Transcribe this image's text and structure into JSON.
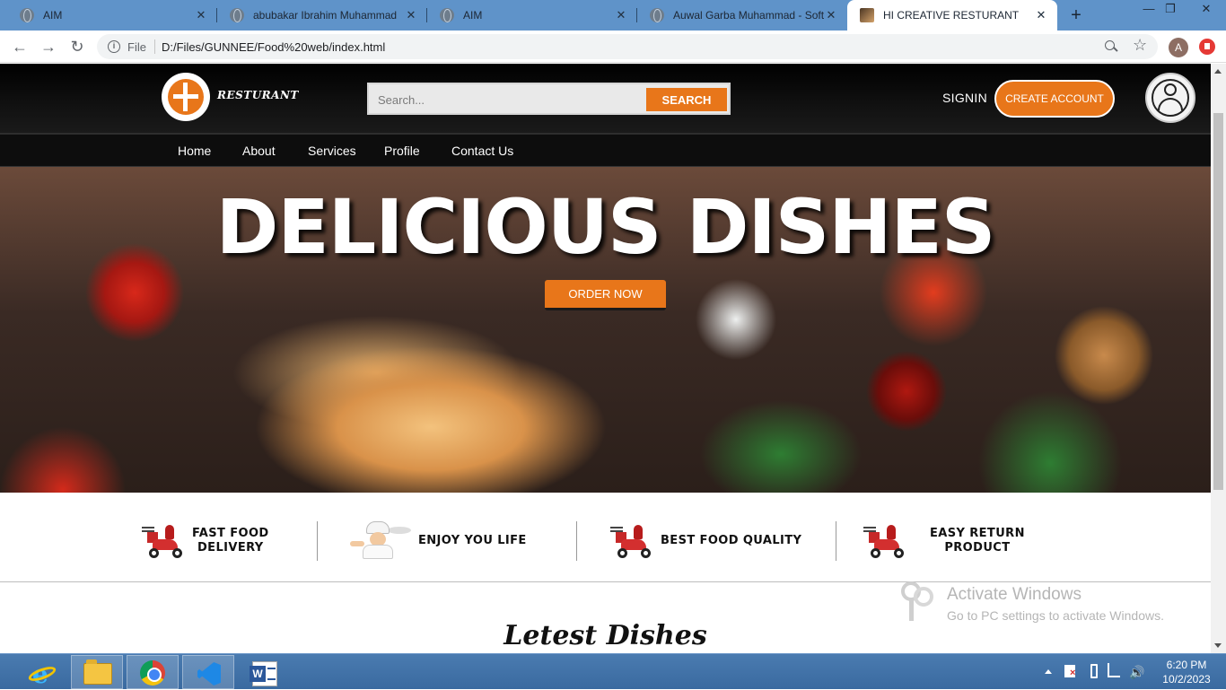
{
  "browser": {
    "tabs": [
      {
        "title": "AIM",
        "icon": "globe-icon",
        "active": false
      },
      {
        "title": "abubakar Ibrahim Muhammad",
        "icon": "globe-icon",
        "active": false
      },
      {
        "title": "AIM",
        "icon": "globe-icon",
        "active": false
      },
      {
        "title": "Auwal Garba Muhammad - Soft",
        "icon": "globe-icon",
        "active": false
      },
      {
        "title": "HI CREATIVE RESTURANT",
        "icon": "site-favicon",
        "active": true
      }
    ],
    "new_tab": "+",
    "window_controls": {
      "minimize": "—",
      "restore": "❐",
      "close": "✕"
    },
    "nav": {
      "back": "←",
      "forward": "→",
      "reload": "↻"
    },
    "address": {
      "scheme_label": "File",
      "url": "D:/Files/GUNNEE/Food%20web/index.html"
    },
    "profile_initial": "A"
  },
  "site": {
    "logo_text": "RESTURANT",
    "search": {
      "placeholder": "Search...",
      "button": "SEARCH"
    },
    "signin": "SIGNIN",
    "create_account": "CREATE ACCOUNT",
    "nav": [
      "Home",
      "About",
      "Services",
      "Profile",
      "Contact Us"
    ],
    "hero": {
      "title": "DELICIOUS DISHES",
      "cta": "ORDER NOW"
    },
    "features": [
      {
        "line1": "FAST FOOD",
        "line2": "DELIVERY",
        "icon": "scooter-icon"
      },
      {
        "line1": "ENJOY YOU LIFE",
        "line2": "",
        "icon": "chef-icon"
      },
      {
        "line1": "BEST FOOD QUALITY",
        "line2": "",
        "icon": "scooter-icon"
      },
      {
        "line1": "EASY RETURN",
        "line2": "PRODUCT",
        "icon": "scooter-icon"
      }
    ],
    "section_title": "Letest Dishes",
    "colors": {
      "accent": "#e8761a",
      "header_bg": "#000000",
      "nav_bg": "#0d0d0d"
    }
  },
  "watermark": {
    "title": "Activate Windows",
    "subtitle": "Go to PC settings to activate Windows."
  },
  "taskbar": {
    "apps": [
      "ie-icon",
      "file-explorer-icon",
      "chrome-icon",
      "vscode-icon",
      "word-icon"
    ],
    "clock": {
      "time": "6:20 PM",
      "date": "10/2/2023"
    },
    "volume_glyph": "🔊"
  }
}
